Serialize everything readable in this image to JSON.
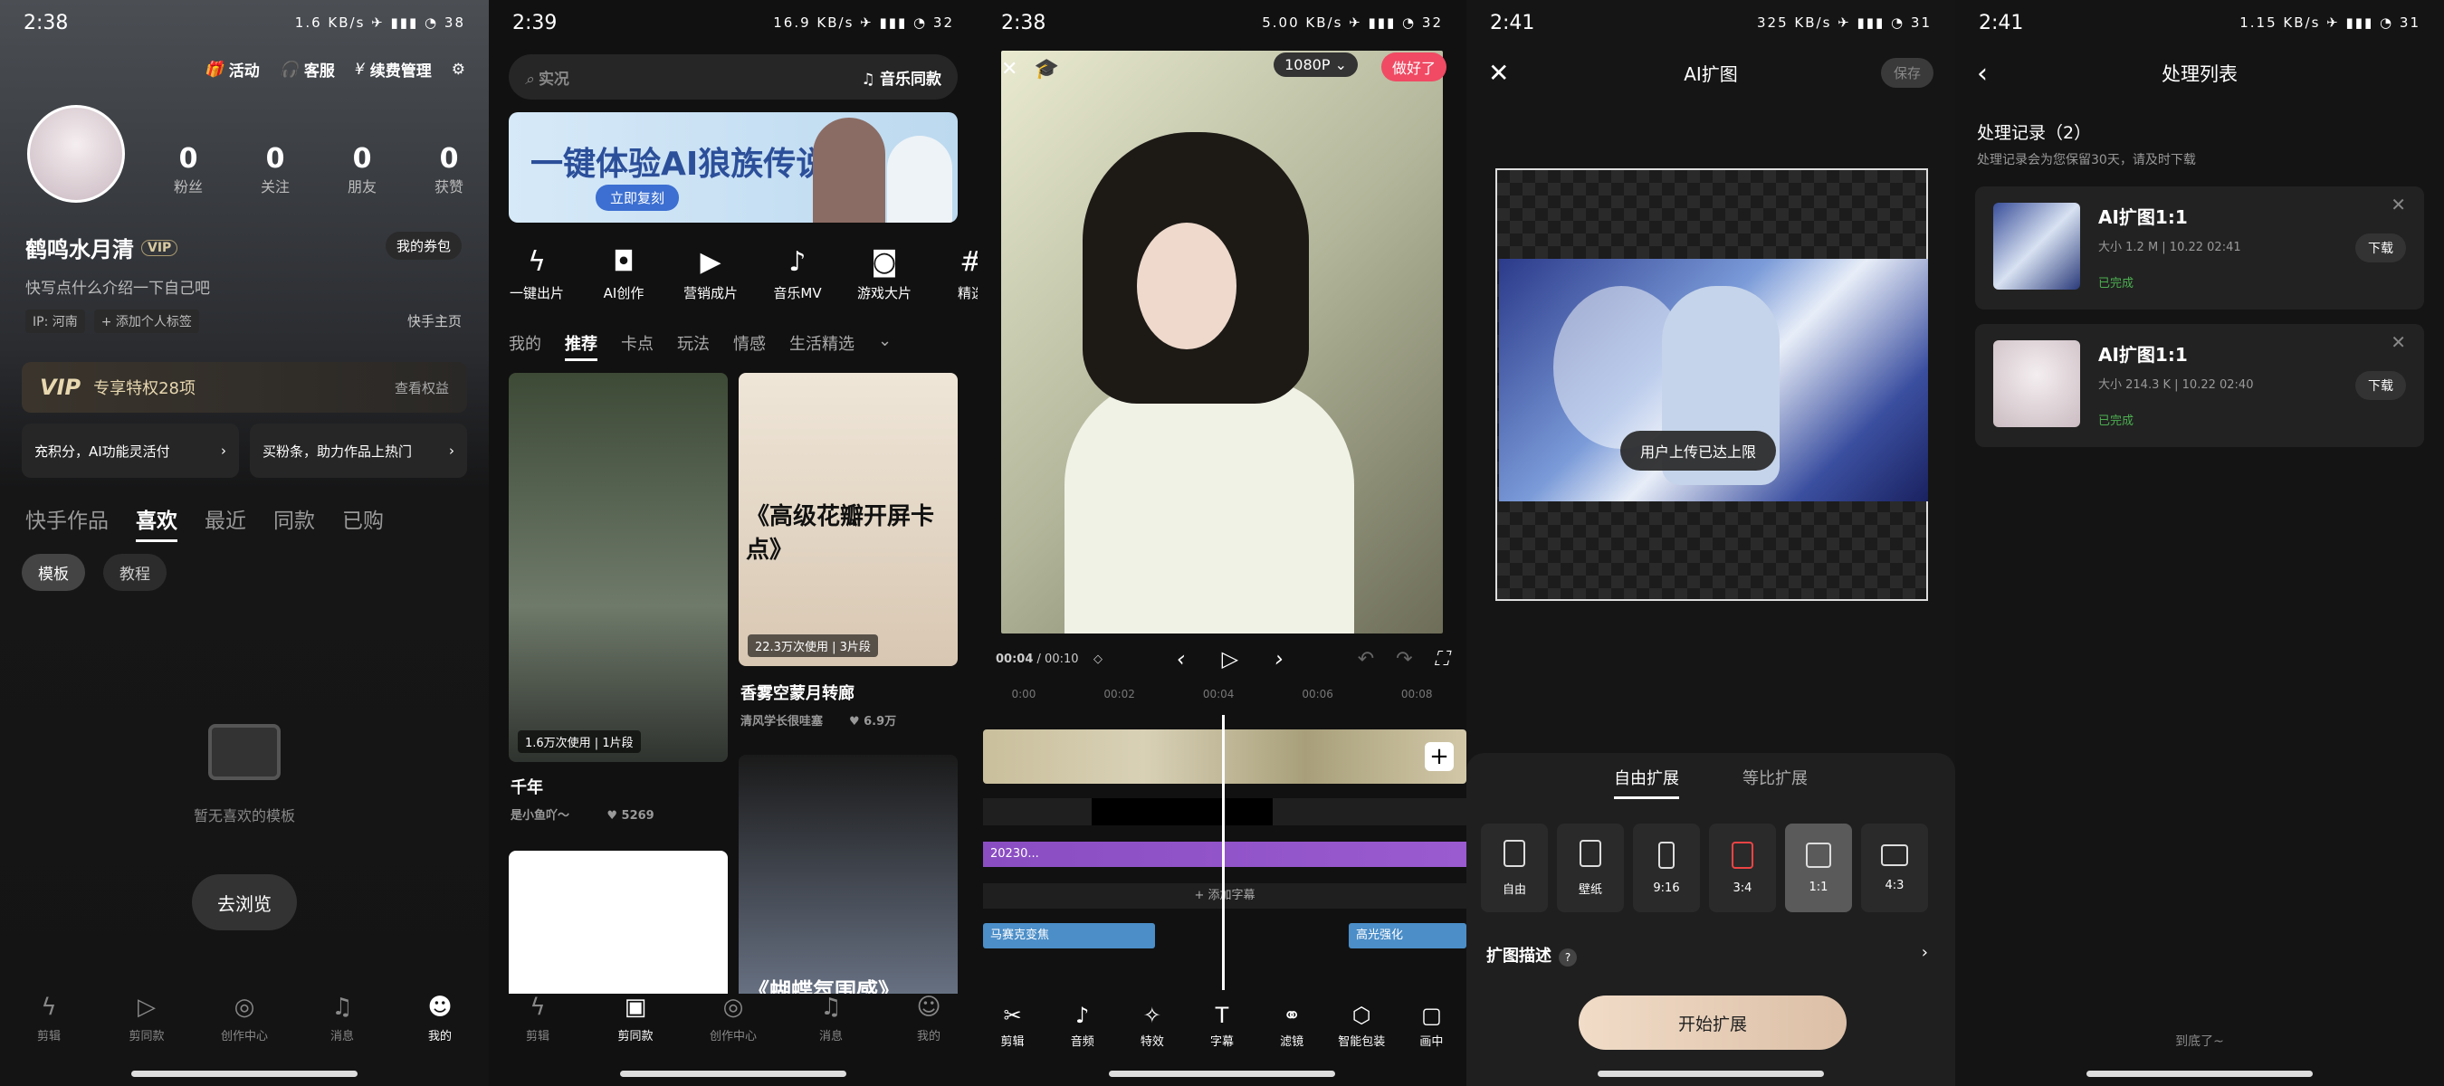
{
  "p1": {
    "time": "2:38",
    "status_icons": "1.6 KB/s ✈ ▮▮▮ ◔ 38",
    "top_links": [
      "活动",
      "客服",
      "续费管理"
    ],
    "stats": [
      {
        "num": "0",
        "label": "粉丝"
      },
      {
        "num": "0",
        "label": "关注"
      },
      {
        "num": "0",
        "label": "朋友"
      },
      {
        "num": "0",
        "label": "获赞"
      }
    ],
    "username": "鹤鸣水月清",
    "vip": "VIP",
    "coupon": "我的券包",
    "bio": "快写点什么介绍一下自己吧",
    "tag_ip": "IP: 河南",
    "tag_add": "+ 添加个人标签",
    "homepage": "快手主页",
    "vip_title": "VIP",
    "vip_desc": "专享特权28项",
    "vip_link": "查看权益",
    "promo1": "充积分，AI功能灵活付",
    "promo2": "买粉条，助力作品上热门",
    "tabs": [
      "快手作品",
      "喜欢",
      "最近",
      "同款",
      "已购"
    ],
    "chips": [
      "模板",
      "教程"
    ],
    "empty_text": "暂无喜欢的模板",
    "browse": "去浏览",
    "nav": [
      "剪辑",
      "剪同款",
      "创作中心",
      "消息",
      "我的"
    ]
  },
  "p2": {
    "time": "2:39",
    "status_icons": "16.9 KB/s ✈ ▮▮▮ ◔ 32",
    "search_placeholder": "实况",
    "search_music": "音乐同款",
    "banner_title": "一键体验AI狼族传说",
    "banner_btn": "立即复刻",
    "feats": [
      "一键出片",
      "AI创作",
      "营销成片",
      "音乐MV",
      "游戏大片",
      "精选"
    ],
    "cats": [
      "我的",
      "推荐",
      "卡点",
      "玩法",
      "情感",
      "生活精选"
    ],
    "card1_badge": "1.6万次使用 | 1片段",
    "card1_title": "千年",
    "card1_author": "是小鱼吖～",
    "card1_likes": "♥ 5269",
    "card2_text": "《高级花瓣开屏卡点》",
    "card2_badge": "22.3万次使用 | 3片段",
    "card2_title": "香雾空蒙月转廊",
    "card2_author": "清风学长很哇塞",
    "card2_likes": "♥ 6.9万",
    "card4_text": "《蝴蝶氛围感》",
    "nav": [
      "剪辑",
      "剪同款",
      "创作中心",
      "消息",
      "我的"
    ]
  },
  "p3": {
    "time": "2:38",
    "status_icons": "5.00 KB/s ✈ ▮▮▮ ◔ 32",
    "resolution": "1080P",
    "done": "做好了",
    "time_current": "00:04",
    "time_total": "/ 00:10",
    "ruler": [
      "0:00",
      "00:02",
      "00:04",
      "00:06",
      "00:08"
    ],
    "music_clip": "20230...",
    "add_subtitle": "+ 添加字幕",
    "effect1": "马赛克变焦",
    "effect2": "高光强化",
    "tools": [
      "剪辑",
      "音频",
      "特效",
      "字幕",
      "滤镜",
      "智能包装",
      "画中"
    ]
  },
  "p4": {
    "time": "2:41",
    "status_icons": "325 KB/s ✈ ▮▮▮ ◔ 31",
    "title": "AI扩图",
    "save": "保存",
    "toast": "用户上传已达上限",
    "tabs": [
      "自由扩展",
      "等比扩展"
    ],
    "ratios": [
      "自由",
      "壁纸",
      "9:16",
      "3:4",
      "1:1",
      "4:3"
    ],
    "desc": "扩图描述",
    "start": "开始扩展"
  },
  "p5": {
    "time": "2:41",
    "status_icons": "1.15 KB/s ✈ ▮▮▮ ◔ 31",
    "title": "处理列表",
    "rec_title": "处理记录（2）",
    "rec_sub": "处理记录会为您保留30天，请及时下载",
    "records": [
      {
        "name": "AI扩图1:1",
        "size": "大小 1.2 M  |  10.22 02:41",
        "status": "已完成",
        "dl": "下载"
      },
      {
        "name": "AI扩图1:1",
        "size": "大小 214.3 K  |  10.22 02:40",
        "status": "已完成",
        "dl": "下载"
      }
    ],
    "end": "到底了~"
  }
}
